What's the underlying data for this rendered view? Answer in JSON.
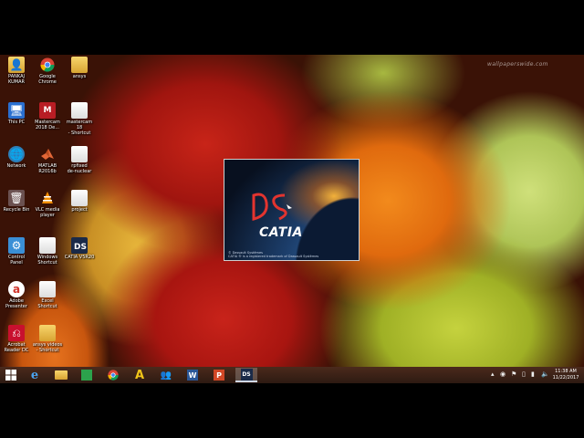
{
  "watermark": "wallpaperswide.com",
  "desktop_icons": [
    {
      "label": "PANKAJ\nKUMAR",
      "icon": "user-folder-icon"
    },
    {
      "label": "Google\nChrome",
      "icon": "chrome-icon"
    },
    {
      "label": "ansys",
      "icon": "folder-icon"
    },
    {
      "label": "This PC",
      "icon": "this-pc-icon"
    },
    {
      "label": "Mastercam\n2018 De...",
      "icon": "mastercam-icon"
    },
    {
      "label": "mastercam 18\n- Shortcut",
      "icon": "shortcut-file-icon"
    },
    {
      "label": "Network",
      "icon": "network-icon"
    },
    {
      "label": "MATLAB\nR2016b",
      "icon": "matlab-icon"
    },
    {
      "label": "rpfixed\nde-nuclear",
      "icon": "document-icon"
    },
    {
      "label": "Recycle Bin",
      "icon": "recycle-bin-icon"
    },
    {
      "label": "VLC media\nplayer",
      "icon": "vlc-icon"
    },
    {
      "label": "project",
      "icon": "document-icon"
    },
    {
      "label": "Control\nPanel",
      "icon": "control-panel-icon"
    },
    {
      "label": "Windows\nShortcut",
      "icon": "shortcut-file-icon"
    },
    {
      "label": "CATIA V5R20",
      "icon": "catia-icon"
    },
    {
      "label": "Adobe\nPresenter",
      "icon": "adobe-presenter-icon"
    },
    {
      "label": "Excel\nShortcut",
      "icon": "shortcut-file-icon"
    },
    {
      "label": "Acrobat\nReader DC",
      "icon": "acrobat-icon"
    },
    {
      "label": "ansys videos\n- Shortcut",
      "icon": "shortcut-file-icon"
    }
  ],
  "splash": {
    "brand": "CATIA",
    "legal": "© Dassault Systèmes\nCATIA ® is a registered trademark of Dassault Systèmes"
  },
  "taskbar": {
    "apps": [
      "start-icon",
      "ie-icon",
      "file-explorer-icon",
      "store-icon",
      "chrome-icon",
      "autocad-icon",
      "people-icon",
      "word-icon",
      "powerpoint-icon",
      "catia-icon"
    ],
    "active": "catia-icon",
    "clock_time": "11:38 AM",
    "clock_date": "11/22/2017"
  },
  "colors": {
    "taskbar": "#2d1a12",
    "catia_blue": "#1c3e6b",
    "ds_red": "#e3342f"
  }
}
